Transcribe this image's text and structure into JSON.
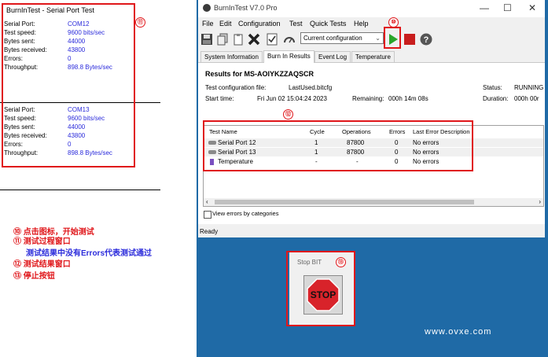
{
  "left_panel": {
    "title": "BurnInTest - Serial Port Test",
    "blocks": [
      {
        "rows": [
          {
            "label": "Serial Port:",
            "value": "COM12"
          },
          {
            "label": "Test speed:",
            "value": "9600 bits/sec"
          },
          {
            "label": "Bytes sent:",
            "value": "44000"
          },
          {
            "label": "Bytes received:",
            "value": "43800"
          },
          {
            "label": "Errors:",
            "value": "0"
          },
          {
            "label": "Throughput:",
            "value": "898.8 Bytes/sec"
          }
        ]
      },
      {
        "rows": [
          {
            "label": "Serial Port:",
            "value": "COM13"
          },
          {
            "label": "Test speed:",
            "value": "9600 bits/sec"
          },
          {
            "label": "Bytes sent:",
            "value": "44000"
          },
          {
            "label": "Bytes received:",
            "value": "43800"
          },
          {
            "label": "Errors:",
            "value": "0"
          },
          {
            "label": "Throughput:",
            "value": "898.8 Bytes/sec"
          }
        ]
      }
    ]
  },
  "annotations": {
    "n10": "⑩",
    "n11": "⑪",
    "n12": "⑫",
    "n13": "⑬",
    "legend": [
      {
        "num": "⑩",
        "text": "点击图标，开始测试",
        "color": "#e0161a"
      },
      {
        "num": "⑪",
        "text": "测试过程窗口",
        "color": "#e0161a"
      },
      {
        "num": "",
        "text": "测试结果中没有Errors代表测试通过",
        "color": "#2b2bdb"
      },
      {
        "num": "⑫",
        "text": "测试结果窗口",
        "color": "#e0161a"
      },
      {
        "num": "⑬",
        "text": "停止按钮",
        "color": "#e0161a"
      }
    ]
  },
  "app": {
    "title": "BurnInTest V7.0 Pro",
    "menu": [
      "File",
      "Edit",
      "Configuration",
      "Test",
      "Quick Tests",
      "Help"
    ],
    "config_select": "Current configuration",
    "tabs": [
      "System Information",
      "Burn In Results",
      "Event Log",
      "Temperature"
    ],
    "results_heading": "Results for MS-AOIYKZZAQSCR",
    "config_file_label": "Test configuration file:",
    "config_file": "LastUsed.bitcfg",
    "start_label": "Start time:",
    "start_time": "Fri Jun 02 15:04:24 2023",
    "remaining_label": "Remaining:",
    "remaining": "000h 14m 08s",
    "status_label": "Status:",
    "status": "RUNNING",
    "duration_label": "Duration:",
    "duration": "000h 00r",
    "table_headers": [
      "Test Name",
      "Cycle",
      "Operations",
      "Errors",
      "Last Error Description"
    ],
    "rows": [
      {
        "name": "Serial Port 12",
        "cycle": "1",
        "ops": "87800",
        "errors": "0",
        "desc": "No errors"
      },
      {
        "name": "Serial Port 13",
        "cycle": "1",
        "ops": "87800",
        "errors": "0",
        "desc": "No errors"
      },
      {
        "name": "Temperature",
        "cycle": "-",
        "ops": "-",
        "errors": "0",
        "desc": "No errors"
      }
    ],
    "view_errors": "View errors by categories",
    "statusbar": "Ready"
  },
  "stop_window": {
    "title": "Stop BIT",
    "button": "STOP"
  },
  "watermark": "www.ovxe.com",
  "colors": {
    "annotation_red": "#e0161a",
    "value_blue": "#2b2bdb",
    "desktop": "#1f6aa6",
    "play_green": "#2aa52a",
    "stop_red": "#c81e1e"
  }
}
